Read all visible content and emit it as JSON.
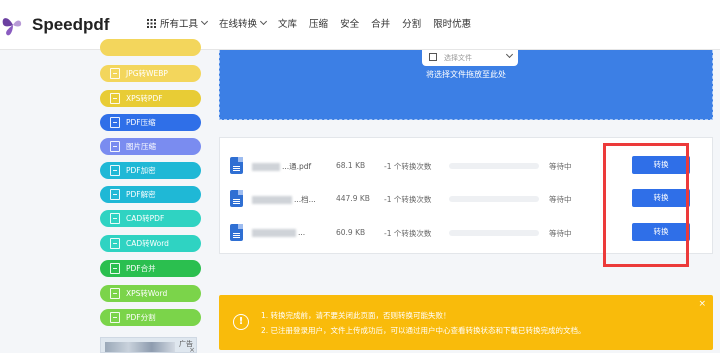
{
  "brand": {
    "name": "Speedpdf",
    "logo_color": "#6b3fa0"
  },
  "nav": [
    {
      "label": "所有工具",
      "icon": "grid-icon",
      "dropdown": true
    },
    {
      "label": "在线转换",
      "dropdown": true
    },
    {
      "label": "文库"
    },
    {
      "label": "压缩"
    },
    {
      "label": "安全"
    },
    {
      "label": "合并"
    },
    {
      "label": "分割"
    },
    {
      "label": "限时优惠"
    }
  ],
  "sidebar": {
    "items": [
      {
        "label": "",
        "color": "#f3d65c"
      },
      {
        "label": "JPG转WEBP",
        "color": "#f3d65c"
      },
      {
        "label": "XPS转PDF",
        "color": "#e8cc35"
      },
      {
        "label": "PDF压缩",
        "color": "#2f6fe8"
      },
      {
        "label": "图片压缩",
        "color": "#7a8cf0"
      },
      {
        "label": "PDF加密",
        "color": "#1fb8d6"
      },
      {
        "label": "PDF解密",
        "color": "#1fb8d6"
      },
      {
        "label": "CAD转PDF",
        "color": "#2fd3c2"
      },
      {
        "label": "CAD转Word",
        "color": "#2fd3c2"
      },
      {
        "label": "PDF合并",
        "color": "#2bbf4f"
      },
      {
        "label": "XPS转Word",
        "color": "#7bd44a"
      },
      {
        "label": "PDF分割",
        "color": "#7bd44a"
      }
    ],
    "ad": {
      "label": "广告",
      "close": "×"
    }
  },
  "upload": {
    "button_label": "选择文件",
    "hint": "将选择文件拖放至此处"
  },
  "files": [
    {
      "name_suffix": "...通.pdf",
      "size": "68.1 KB",
      "count": "-1 个转换次数",
      "progress": 0,
      "status": "等待中",
      "action": "转换"
    },
    {
      "name_suffix": "...档...",
      "size": "447.9 KB",
      "count": "-1 个转换次数",
      "progress": 0,
      "status": "等待中",
      "action": "转换"
    },
    {
      "name_suffix": "...",
      "size": "60.9 KB",
      "count": "-1 个转换次数",
      "progress": 0,
      "status": "等待中",
      "action": "转换"
    }
  ],
  "notice": {
    "icon": "!",
    "line1": "1. 转换完成前，请不要关闭此页面，否则转换可能失败！",
    "line2": "2. 已注册登录用户，文件上传成功后，可以通过用户中心查看转换状态和下载已转换完成的文档。",
    "close": "×",
    "color": "#f9bb0b"
  },
  "colors": {
    "accent": "#2f6fe8",
    "highlight": "#ec3a3a"
  }
}
